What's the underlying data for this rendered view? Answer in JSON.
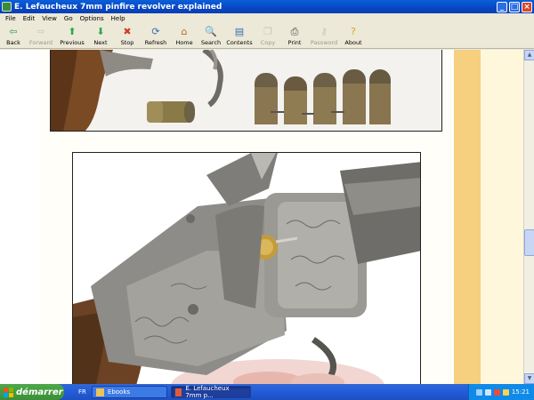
{
  "window": {
    "title": "E. Lefaucheux 7mm pinfire revolver explained",
    "buttons": {
      "minimize": "_",
      "maximize": "□",
      "close": "×"
    }
  },
  "menu": [
    "File",
    "Edit",
    "View",
    "Go",
    "Options",
    "Help"
  ],
  "toolbar": [
    {
      "label": "Back",
      "icon": "back-arrow-icon",
      "glyph": "⇦",
      "color": "#2d9a5c",
      "enabled": true
    },
    {
      "label": "Forward",
      "icon": "forward-arrow-icon",
      "glyph": "⇨",
      "color": "#9a9a9a",
      "enabled": false
    },
    {
      "label": "Previous",
      "icon": "previous-arrow-icon",
      "glyph": "⬆",
      "color": "#2fa84a",
      "enabled": true
    },
    {
      "label": "Next",
      "icon": "next-arrow-icon",
      "glyph": "⬇",
      "color": "#2fa84a",
      "enabled": true
    },
    {
      "label": "Stop",
      "icon": "stop-icon",
      "glyph": "✖",
      "color": "#d33a26",
      "enabled": true
    },
    {
      "label": "Refresh",
      "icon": "refresh-icon",
      "glyph": "⟳",
      "color": "#3b6fb0",
      "enabled": true
    },
    {
      "label": "Home",
      "icon": "home-icon",
      "glyph": "⌂",
      "color": "#b4672c",
      "enabled": true
    },
    {
      "label": "Search",
      "icon": "search-icon",
      "glyph": "🔍",
      "color": "#4a4a4a",
      "enabled": true
    },
    {
      "label": "Contents",
      "icon": "contents-icon",
      "glyph": "▤",
      "color": "#3a6ab8",
      "enabled": true
    },
    {
      "label": "Copy",
      "icon": "copy-icon",
      "glyph": "❐",
      "color": "#9a9a9a",
      "enabled": false
    },
    {
      "label": "Print",
      "icon": "print-icon",
      "glyph": "⎙",
      "color": "#444",
      "enabled": true
    },
    {
      "label": "Password",
      "icon": "password-icon",
      "glyph": "⚷",
      "color": "#9a9a9a",
      "enabled": false
    },
    {
      "label": "About",
      "icon": "about-icon",
      "glyph": "?",
      "color": "#d9a12a",
      "enabled": true
    }
  ],
  "taskbar": {
    "start_label": "démarrer",
    "language": "FR",
    "tasks": [
      {
        "label": "Ebooks",
        "active": false,
        "icon": "folder-icon",
        "color": "#e8c45a"
      },
      {
        "label": "E. Lefaucheux 7mm p...",
        "active": true,
        "icon": "ebook-icon",
        "color": "#e05a3a"
      }
    ],
    "clock": "15:21"
  },
  "colors": {
    "accent": "#245edb",
    "side_strip": "#f6cf7f"
  }
}
